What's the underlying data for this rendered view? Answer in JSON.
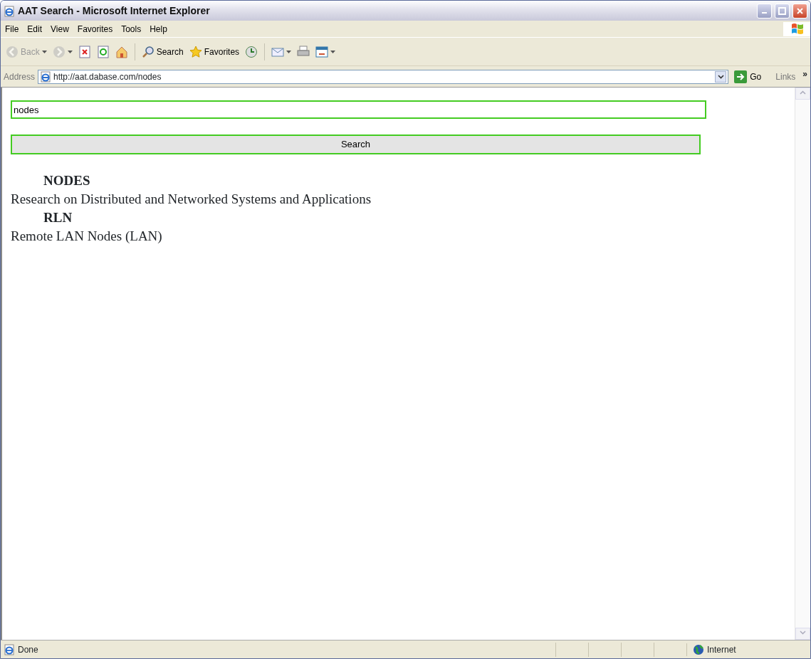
{
  "window": {
    "title": "AAT Search - Microsoft Internet Explorer"
  },
  "menu": [
    "File",
    "Edit",
    "View",
    "Favorites",
    "Tools",
    "Help"
  ],
  "toolbar": [
    {
      "kind": "back",
      "label": "Back",
      "disabled": true,
      "dropdown": true
    },
    {
      "kind": "forward",
      "disabled": true,
      "dropdown": true
    },
    {
      "kind": "stop",
      "disabled": false,
      "dropdown": false
    },
    {
      "kind": "refresh",
      "disabled": false,
      "dropdown": false
    },
    {
      "kind": "home",
      "disabled": false,
      "dropdown": false
    },
    {
      "kind": "separator"
    },
    {
      "kind": "search",
      "label": "Search",
      "disabled": false,
      "dropdown": false
    },
    {
      "kind": "favorites",
      "label": "Favorites",
      "disabled": false,
      "dropdown": false
    },
    {
      "kind": "history",
      "disabled": false,
      "dropdown": false
    },
    {
      "kind": "separator"
    },
    {
      "kind": "mail",
      "disabled": false,
      "dropdown": true
    },
    {
      "kind": "print",
      "disabled": false,
      "dropdown": false
    },
    {
      "kind": "edit",
      "disabled": false,
      "dropdown": true
    }
  ],
  "address_bar": {
    "label": "Address",
    "url": "http://aat.dabase.com/nodes",
    "go": "Go",
    "links": "Links",
    "more": "»"
  },
  "search": {
    "value": "nodes",
    "button": "Search"
  },
  "results": [
    {
      "term": "NODES",
      "description": "Research on Distributed and Networked Systems and Applications"
    },
    {
      "term": "RLN",
      "description": "Remote LAN Nodes (LAN)"
    }
  ],
  "status_bar": {
    "text": "Done",
    "zone": "Internet"
  }
}
